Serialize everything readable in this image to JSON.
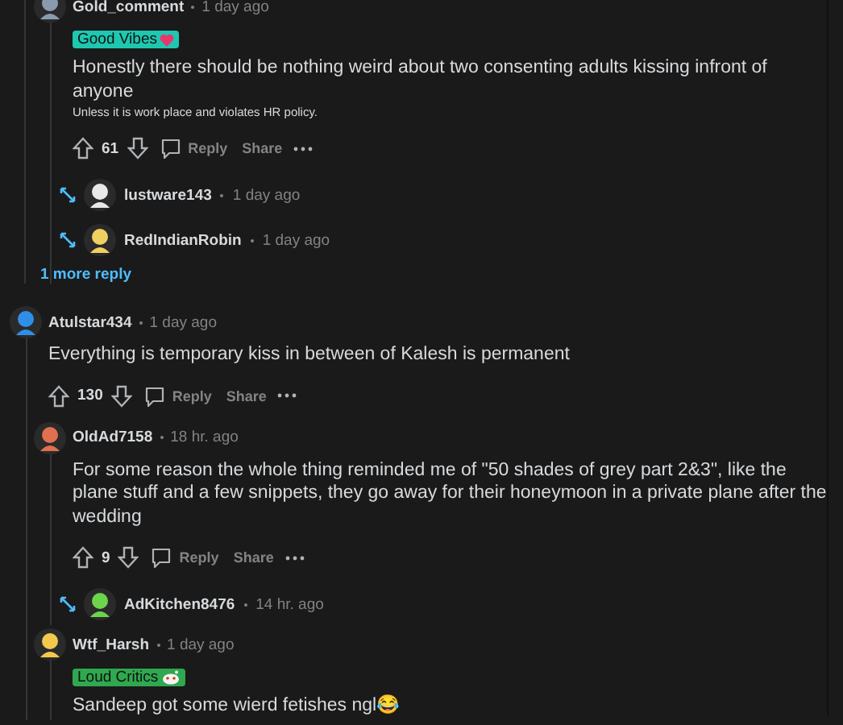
{
  "comments": [
    {
      "author": "Gold_comment",
      "time": "1 day ago",
      "flair": {
        "text": "Good Vibes",
        "color": "#1ec8b0"
      },
      "body": "Honestly there should be nothing weird about two consenting adults kissing infront of anyone",
      "note": "Unless it is work place and violates HR policy.",
      "votes": "61",
      "actions": [
        "Reply",
        "Share"
      ],
      "replies": [
        {
          "author": "lustware143",
          "time": "1 day ago",
          "collapsed": true
        },
        {
          "author": "RedIndianRobin",
          "time": "1 day ago",
          "collapsed": true
        }
      ],
      "more": "1 more reply"
    },
    {
      "author": "Atulstar434",
      "time": "1 day ago",
      "body": "Everything is temporary kiss in between of Kalesh is permanent",
      "votes": "130",
      "actions": [
        "Reply",
        "Share"
      ],
      "replies": [
        {
          "author": "OldAd7158",
          "time": "18 hr. ago",
          "body": "For some reason the whole thing reminded me of \"50 shades of grey part 2&3\", like the plane stuff and a few snippets, they go away for their honeymoon in a private plane after the wedding",
          "votes": "9",
          "actions": [
            "Reply",
            "Share"
          ],
          "replies": [
            {
              "author": "AdKitchen8476",
              "time": "14 hr. ago",
              "collapsed": true
            }
          ]
        },
        {
          "author": "Wtf_Harsh",
          "time": "1 day ago",
          "flair": {
            "text": "Loud Critics",
            "color": "#2fa84f"
          },
          "body": "Sandeep got some wierd fetishes ngl😂"
        }
      ]
    }
  ]
}
